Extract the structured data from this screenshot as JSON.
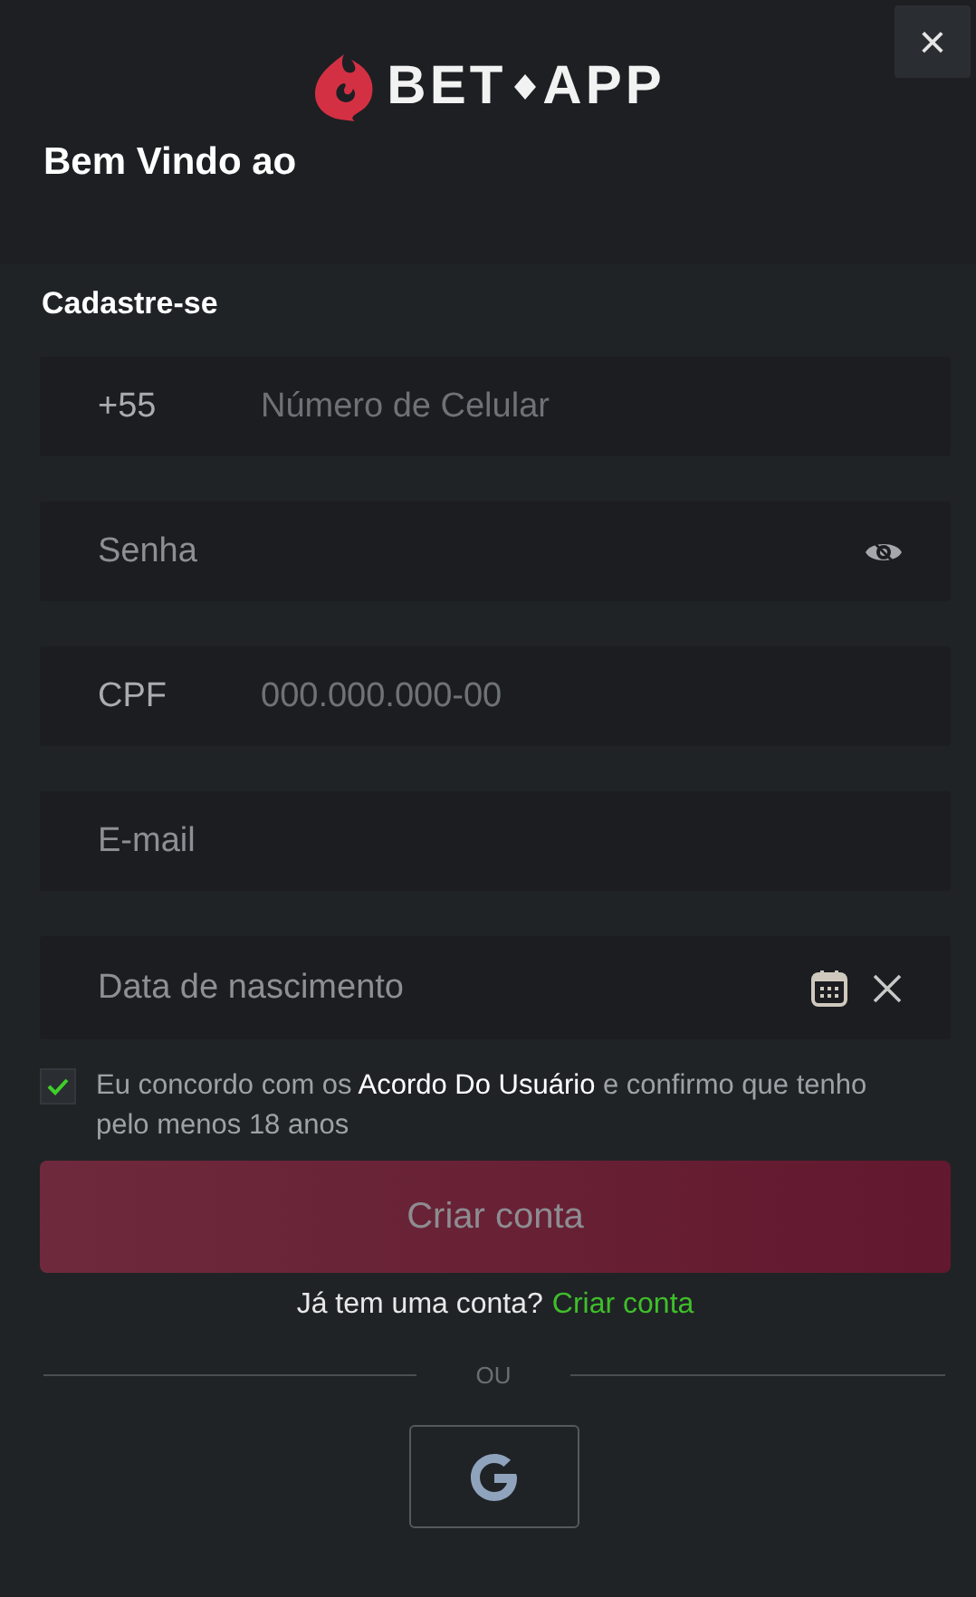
{
  "logo": {
    "text_left": "BET",
    "text_right": "APP"
  },
  "close_button": {
    "label": "×"
  },
  "welcome": "Bem Vindo ao",
  "form": {
    "title": "Cadastre-se",
    "fields": [
      {
        "kind": "phone",
        "prefix": "+55",
        "placeholder": "Número de Celular"
      },
      {
        "kind": "password",
        "placeholder": "Senha"
      },
      {
        "kind": "cpf",
        "prefix": "CPF",
        "placeholder": "000.000.000-00"
      },
      {
        "kind": "email",
        "placeholder": "E-mail"
      },
      {
        "kind": "date",
        "placeholder": "Data de nascimento"
      }
    ],
    "agreement": {
      "checked": true,
      "text": "Eu concordo com os **Acordo Do Usuário** e confirmo que tenho pelo menos 18 anos"
    },
    "submit": {
      "label": "Criar conta",
      "disabled": true
    },
    "login_prompt": {
      "text": "Já tem uma conta?",
      "link": "Criar conta"
    },
    "divider": "OU"
  }
}
